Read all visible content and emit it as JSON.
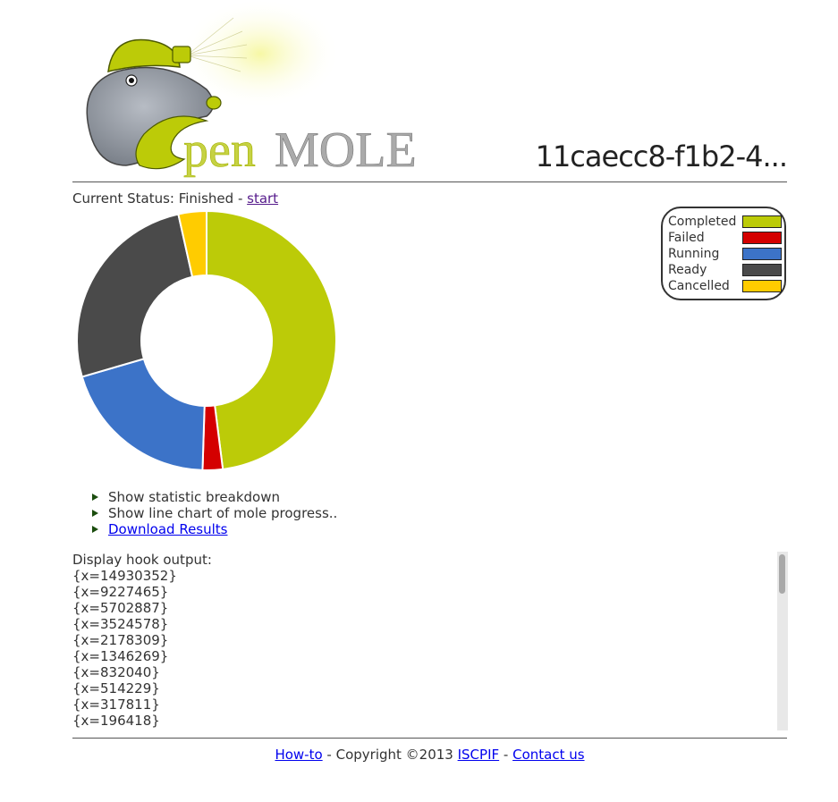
{
  "header": {
    "logo_text_1": "pen",
    "logo_text_2": "MOLE",
    "job_id": "11caecc8-f1b2-4..."
  },
  "status": {
    "label": "Current Status: Finished - ",
    "link": "start"
  },
  "chart_data": {
    "type": "pie",
    "donut": true,
    "slices": [
      {
        "label": "Completed",
        "value": 48,
        "color": "#bccb08"
      },
      {
        "label": "Failed",
        "value": 2.5,
        "color": "#d40000"
      },
      {
        "label": "Running",
        "value": 20,
        "color": "#3c73c8"
      },
      {
        "label": "Ready",
        "value": 26,
        "color": "#4a4a4a"
      },
      {
        "label": "Cancelled",
        "value": 3.5,
        "color": "#ffcc00"
      }
    ]
  },
  "legend": {
    "items": [
      {
        "label": "Completed",
        "color": "#bccb08"
      },
      {
        "label": "Failed",
        "color": "#d40000"
      },
      {
        "label": "Running",
        "color": "#3c73c8"
      },
      {
        "label": "Ready",
        "color": "#4a4a4a"
      },
      {
        "label": "Cancelled",
        "color": "#ffcc00"
      }
    ]
  },
  "actions": {
    "stats": "Show statistic breakdown",
    "progress": "Show line chart of mole progress..",
    "download": "Download Results"
  },
  "hook": {
    "title": "Display hook output:",
    "lines": [
      "{x=14930352}",
      "{x=9227465}",
      "{x=5702887}",
      "{x=3524578}",
      "{x=2178309}",
      "{x=1346269}",
      "{x=832040}",
      "{x=514229}",
      "{x=317811}",
      "{x=196418}"
    ]
  },
  "footer": {
    "howto": "How-to",
    "copyright": " - Copyright ©2013 ",
    "org": "ISCPIF",
    "sep": " - ",
    "contact": "Contact us"
  }
}
